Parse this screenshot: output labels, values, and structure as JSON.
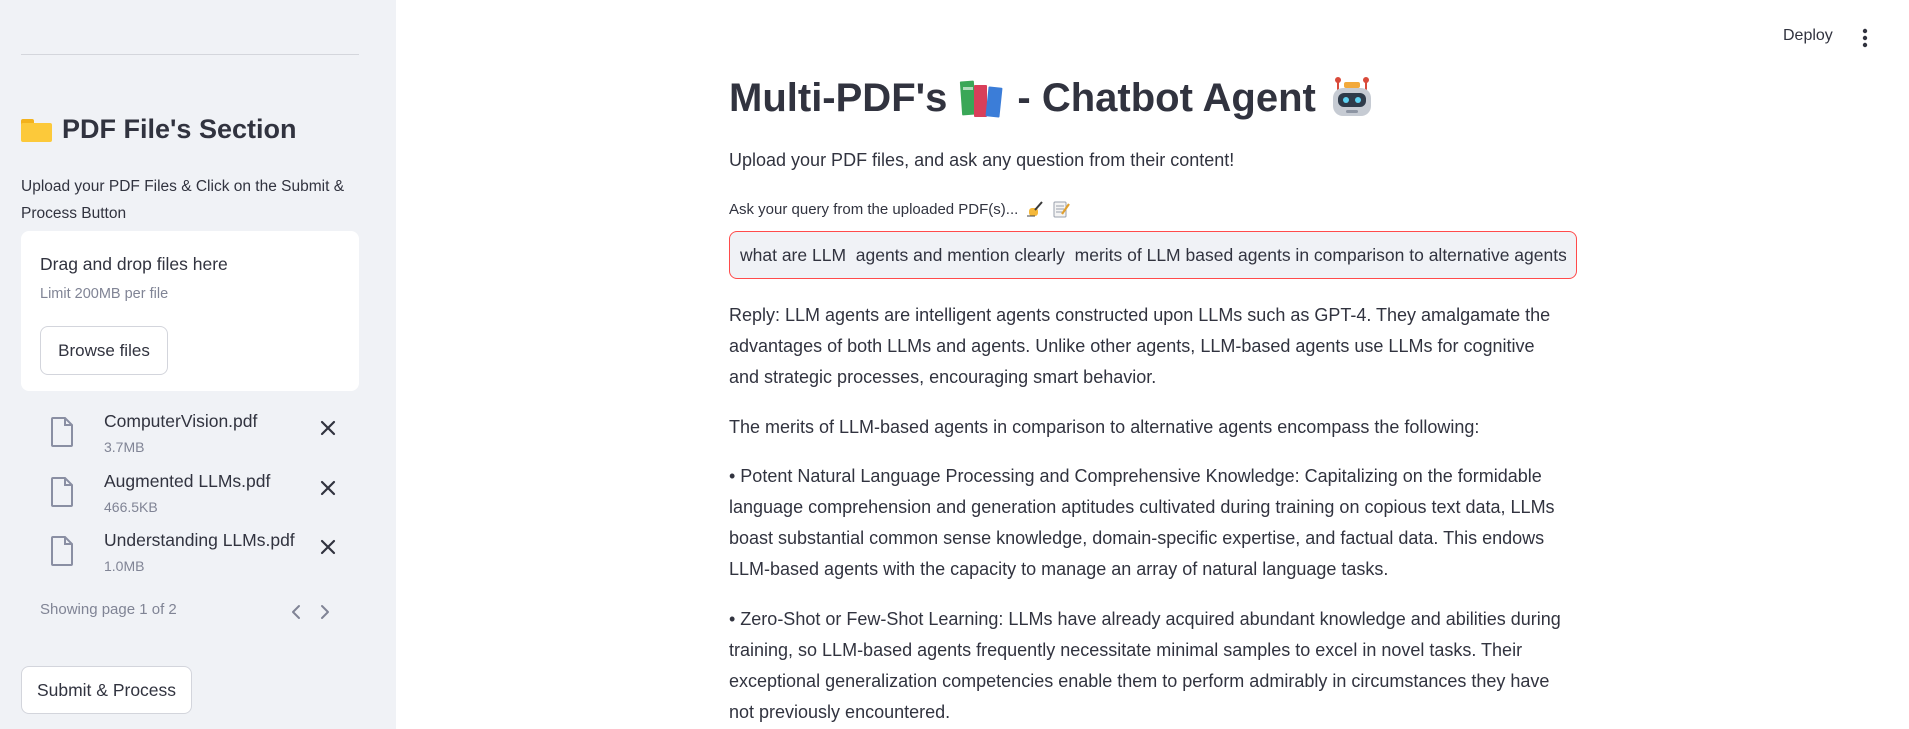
{
  "sidebar": {
    "title": "PDF File's Section",
    "description": "Upload your PDF Files & Click on the Submit & Process Button",
    "uploader": {
      "drag_text": "Drag and drop files here",
      "limit_text": "Limit 200MB per file",
      "browse_label": "Browse files"
    },
    "files": [
      {
        "name": "ComputerVision.pdf",
        "size": "3.7MB"
      },
      {
        "name": "Augmented LLMs.pdf",
        "size": "466.5KB"
      },
      {
        "name": "Understanding LLMs.pdf",
        "size": "1.0MB"
      }
    ],
    "pager_text": "Showing page 1 of 2",
    "submit_label": "Submit & Process"
  },
  "header": {
    "deploy_label": "Deploy"
  },
  "main": {
    "title": "Multi-PDF's",
    "title_suffix": "- Chatbot Agent",
    "subtitle": "Upload your PDF files, and ask any question from their content!",
    "query_label": "Ask your query from the uploaded PDF(s)...",
    "query_value": "what are LLM  agents and mention clearly  merits of LLM based agents in comparison to alternative agents",
    "reply_paragraphs": [
      "Reply: LLM agents are intelligent agents constructed upon LLMs such as GPT-4. They amalgamate the advantages of both LLMs and agents. Unlike other agents, LLM-based agents use LLMs for cognitive and strategic processes, encouraging smart behavior.",
      "The merits of LLM-based agents in comparison to alternative agents encompass the following:",
      "• Potent Natural Language Processing and Comprehensive Knowledge: Capitalizing on the formidable language comprehension and generation aptitudes cultivated during training on copious text data, LLMs boast substantial common sense knowledge, domain-specific expertise, and factual data. This endows LLM-based agents with the capacity to manage an array of natural language tasks.",
      "• Zero-Shot or Few-Shot Learning: LLMs have already acquired abundant knowledge and abilities during training, so LLM-based agents frequently necessitate minimal samples to excel in novel tasks. Their exceptional generalization competencies enable them to perform admirably in circumstances they have not previously encountered."
    ]
  },
  "colors": {
    "sidebar_bg": "#f0f2f6",
    "accent_red": "#ff4b4b",
    "text": "#31333f",
    "muted": "#808495"
  },
  "icons": [
    "folder-icon",
    "file-icon",
    "close-icon",
    "chevron-left-icon",
    "chevron-right-icon",
    "more-vertical-icon",
    "books-icon",
    "robot-icon",
    "writing-hand-icon",
    "memo-icon"
  ]
}
